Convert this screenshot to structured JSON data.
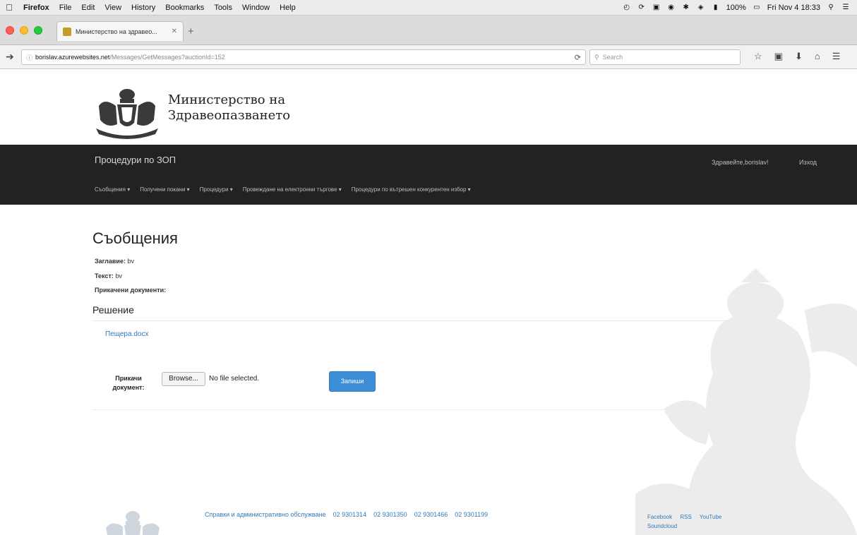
{
  "menubar": {
    "app": "Firefox",
    "items": [
      "File",
      "Edit",
      "View",
      "History",
      "Bookmarks",
      "Tools",
      "Window",
      "Help"
    ],
    "battery": "100%",
    "clock": "Fri Nov 4  18:33"
  },
  "browser": {
    "tab_title": "Министерство на здравео...",
    "url_host": "borislav.azurewebsites.net",
    "url_path": "/Messages/GetMessages?auctionId=152",
    "search_placeholder": "Search"
  },
  "site": {
    "ministry_line1": "Министерство на",
    "ministry_line2": "Здравеопазването",
    "brand": "Процедури по ЗОП",
    "greeting": "Здравейте,borislav!",
    "logout": "Изход",
    "menu": [
      "Съобщения ▾",
      "Получени покани ▾",
      "Процедури ▾",
      "Провеждане на електронни търгове ▾",
      "Процедури по вътрешен конкурентен избор ▾"
    ]
  },
  "content": {
    "title": "Съобщения",
    "field_title_label": "Заглавие:",
    "field_title_value": "bv",
    "field_text_label": "Текст:",
    "field_text_value": "bv",
    "field_attach_label": "Прикачени документи:",
    "decision_heading": "Решение",
    "document_link": "Пещера.docx",
    "attach_label_line1": "Прикачи",
    "attach_label_line2": "документ:",
    "browse_label": "Browse...",
    "no_file_label": "No file selected.",
    "save_label": "Запиши"
  },
  "footer": {
    "services": "Справки и административно обслужване",
    "phones": [
      "02 9301314",
      "02 9301350",
      "02 9301466",
      "02 9301199"
    ],
    "social": [
      "Facebook",
      "RSS",
      "YouTube",
      "Soundcloud"
    ]
  }
}
